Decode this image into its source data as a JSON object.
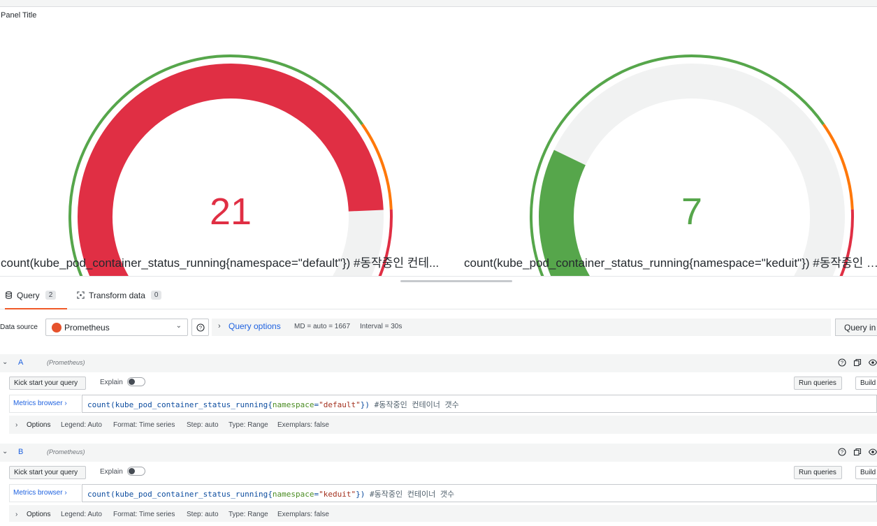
{
  "panel": {
    "title": "Panel Title",
    "gauges": [
      {
        "value": "21",
        "value_num": 21,
        "label": "count(kube_pod_container_status_running{namespace=\"default\"}) #동작중인 컨테...",
        "value_color": "#e02f44"
      },
      {
        "value": "7",
        "value_num": 7,
        "label": "count(kube_pod_container_status_running{namespace=\"keduit\"}) #동작중인 컨테...",
        "value_color": "#56a64b"
      }
    ],
    "threshold_colors": {
      "green": "#56a64b",
      "orange": "#ff780a",
      "red": "#e02f44",
      "track": "#f1f2f2"
    }
  },
  "tabs": [
    {
      "label": "Query",
      "count": "2",
      "icon": "database-icon"
    },
    {
      "label": "Transform data",
      "count": "0",
      "icon": "transform-icon"
    }
  ],
  "datasource": {
    "label": "Data source",
    "selected": "Prometheus",
    "query_options_label": "Query options",
    "md": "MD = auto = 1667",
    "interval": "Interval = 30s",
    "inspector_label": "Query in"
  },
  "queries": [
    {
      "ref_id": "A",
      "ds_name": "(Prometheus)",
      "kick_start": "Kick start your query",
      "explain": "Explain",
      "run": "Run queries",
      "builder": "Build",
      "metrics_browser": "Metrics browser ›",
      "code": {
        "fn": "count(kube_pod_container_status_running{",
        "key": "namespace",
        "eq": "=",
        "str": "\"default\"",
        "close": "})",
        "comment": " #동작중인 컨테이너 갯수"
      },
      "options": {
        "label": "Options",
        "legend": "Legend: Auto",
        "format": "Format: Time series",
        "step": "Step: auto",
        "type": "Type: Range",
        "exemplars": "Exemplars: false"
      }
    },
    {
      "ref_id": "B",
      "ds_name": "(Prometheus)",
      "kick_start": "Kick start your query",
      "explain": "Explain",
      "run": "Run queries",
      "builder": "Build",
      "metrics_browser": "Metrics browser ›",
      "code": {
        "fn": "count(kube_pod_container_status_running{",
        "key": "namespace",
        "eq": "=",
        "str": "\"keduit\"",
        "close": "})",
        "comment": " #동작중인 컨테이너 갯수"
      },
      "options": {
        "label": "Options",
        "legend": "Legend: Auto",
        "format": "Format: Time series",
        "step": "Step: auto",
        "type": "Type: Range",
        "exemplars": "Exemplars: false"
      }
    }
  ]
}
